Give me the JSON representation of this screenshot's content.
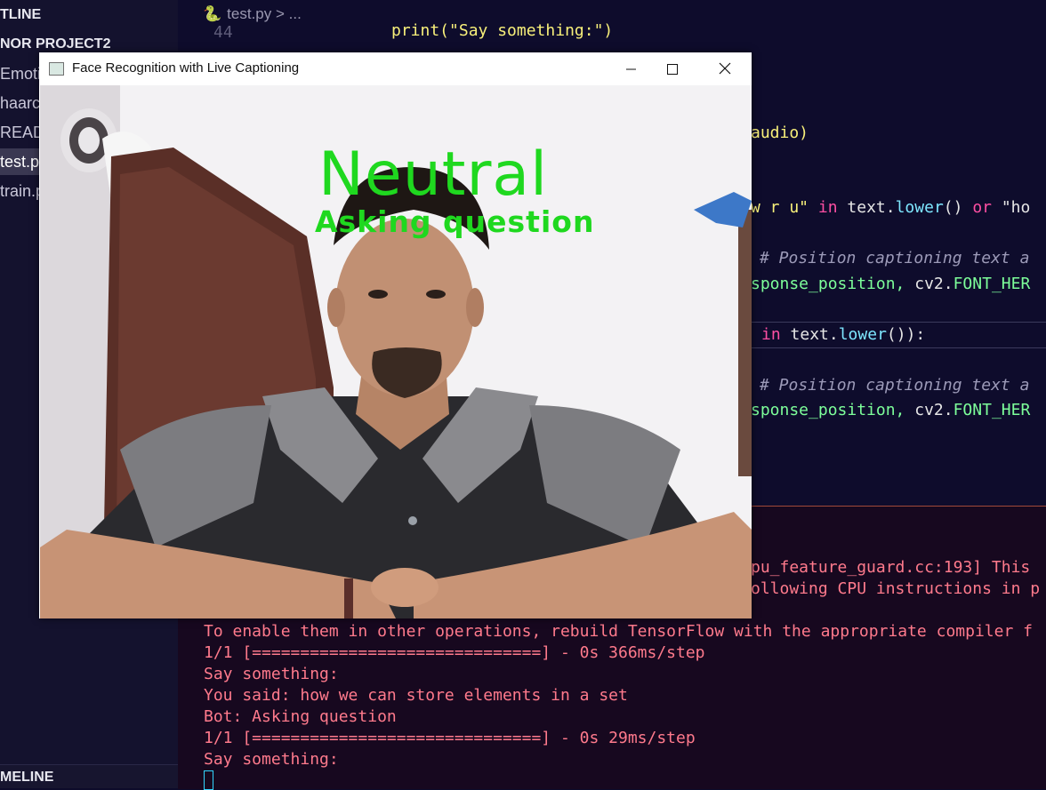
{
  "sidebar": {
    "outline_header": "TLINE",
    "project_header": "NOR PROJECT2",
    "files": [
      "Emoti",
      "haarca",
      "READ",
      "test.py",
      "train.p"
    ],
    "timeline_header": "MELINE"
  },
  "editor": {
    "breadcrumb_file": "test.py",
    "breadcrumb_sep": ">",
    "breadcrumb_more": "...",
    "line_number": "44",
    "lines": {
      "l1": "print(\"Say something:\")",
      "l2": "audio)",
      "l3_a": "w r u\"",
      "l3_in": "in",
      "l3_b": "text.",
      "l3_fn": "lower",
      "l3_c": "()",
      "l3_or": "or",
      "l3_d": "\"ho",
      "l4": "# Position captioning text a",
      "l5_var": "sponse_position,",
      "l5_b": "cv2.",
      "l5_c": "FONT_HER",
      "l6_in": "in",
      "l6_b": "text.",
      "l6_fn": "lower",
      "l6_c": "()):",
      "l7": "# Position captioning text a",
      "l8_var": "sponse_position,",
      "l8_b": "cv2.",
      "l8_c": "FONT_HER"
    }
  },
  "terminal": {
    "lines": [
      "pu_feature_guard.cc:193] This",
      "ollowing CPU instructions in p",
      "To enable them in other operations, rebuild TensorFlow with the appropriate compiler f",
      "1/1 [==============================] - 0s 366ms/step",
      "Say something:",
      "You said: how we can store elements in a set",
      "Bot: Asking question",
      "1/1 [==============================] - 0s 29ms/step",
      "Say something:"
    ]
  },
  "cv_window": {
    "title": "Face Recognition with Live Captioning",
    "emotion_label": "Neutral",
    "caption_label": "Asking question"
  },
  "colors": {
    "overlay_text": "#1fd81f",
    "terminal_text": "#ff7a8c"
  }
}
